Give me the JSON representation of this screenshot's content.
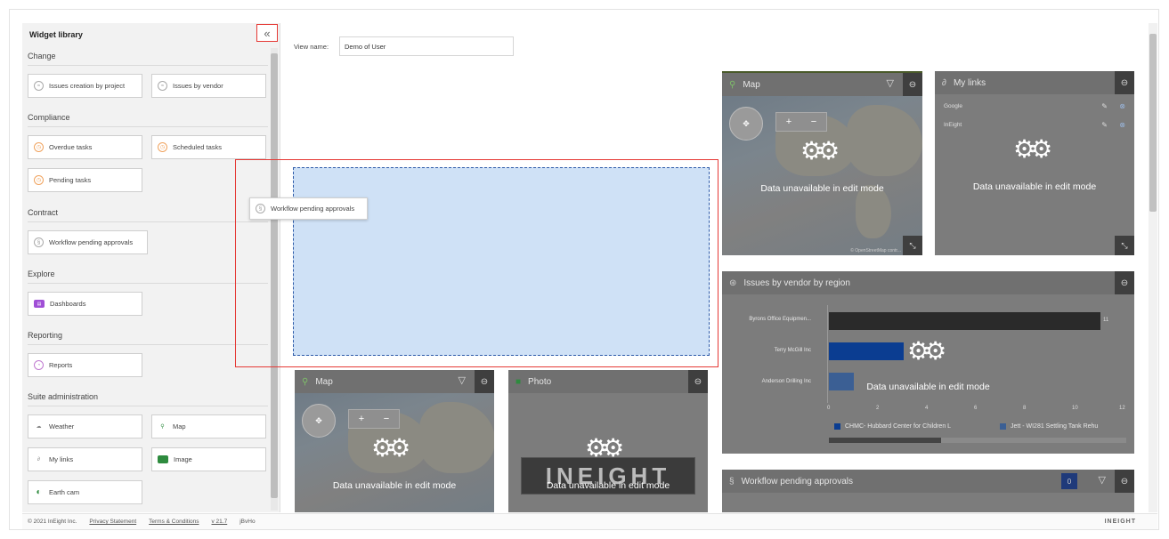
{
  "sidebar": {
    "title": "Widget library",
    "collapse_icon": "«",
    "sections": {
      "change": "Change",
      "compliance": "Compliance",
      "contract": "Contract",
      "explore": "Explore",
      "reporting": "Reporting",
      "suite_admin": "Suite administration"
    },
    "tiles": {
      "issues_creation": "Issues creation by project",
      "issues_vendor": "Issues by vendor",
      "overdue": "Overdue tasks",
      "scheduled": "Scheduled tasks",
      "pending": "Pending tasks",
      "workflow": "Workflow pending approvals",
      "dashboards": "Dashboards",
      "reports": "Reports",
      "weather": "Weather",
      "map": "Map",
      "my_links": "My links",
      "image": "Image",
      "earth_cam": "Earth cam"
    }
  },
  "view": {
    "label": "View name:",
    "value": "Demo of User"
  },
  "drag": {
    "label": "Workflow pending approvals"
  },
  "widgets": {
    "map_top": {
      "title": "Map",
      "unavailable": "Data unavailable in edit mode",
      "osm": "© OpenStreetMap contr..."
    },
    "my_links": {
      "title": "My links",
      "unavailable": "Data unavailable in edit mode",
      "links": [
        "Google",
        "InEight"
      ]
    },
    "issues_region": {
      "title": "Issues by vendor by region",
      "unavailable": "Data unavailable in edit mode",
      "bars": [
        "Byrons Office Equipmen...",
        "Terry McGill Inc",
        "Anderson Drilling Inc"
      ],
      "value_label": "11",
      "ticks": [
        "0",
        "2",
        "4",
        "6",
        "8",
        "10",
        "12"
      ],
      "legend": [
        "CHMC- Hubbard Center for Children L",
        "Jett - WI281 Settling Tank Rehu"
      ]
    },
    "map_bottom": {
      "title": "Map",
      "unavailable": "Data unavailable in edit mode"
    },
    "photo": {
      "title": "Photo",
      "unavailable": "Data unavailable in edit mode",
      "logo": "INEIGHT"
    },
    "workflow": {
      "title": "Workflow pending approvals",
      "badge": "0"
    }
  },
  "footer": {
    "copyright": "© 2021 InEight Inc.",
    "privacy": "Privacy Statement",
    "terms": "Terms & Conditions",
    "version": "v 21.7",
    "build": "jBvHo",
    "brand": "INEIGHT"
  },
  "colors": {
    "accent_red": "#e53935",
    "drop_zone": "#cfe1f6",
    "bar_dark": "#2a2a2a",
    "bar_blue": "#0b3d91"
  }
}
